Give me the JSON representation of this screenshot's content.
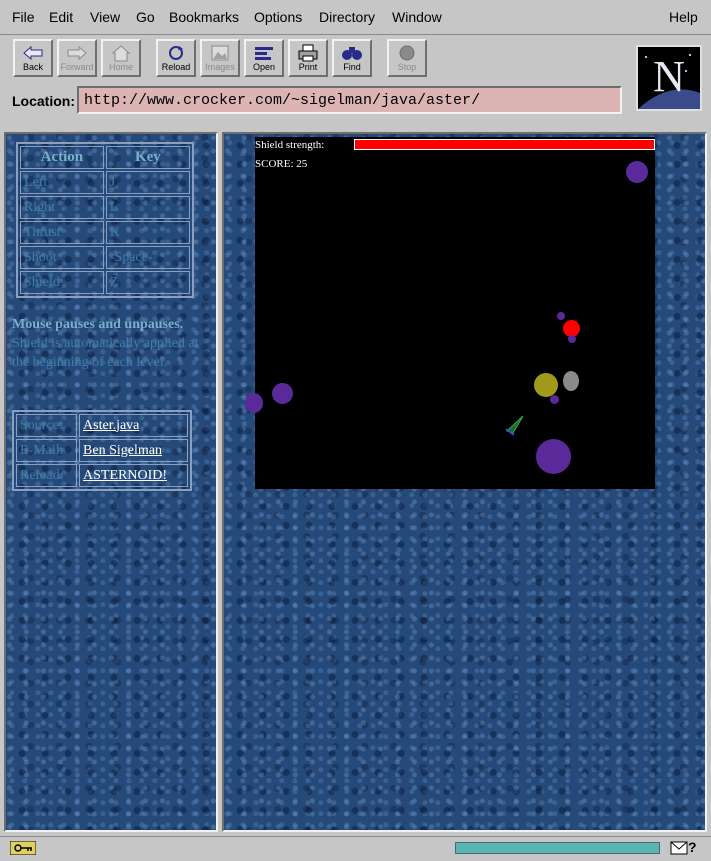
{
  "menu": {
    "file": "File",
    "edit": "Edit",
    "view": "View",
    "go": "Go",
    "bookmarks": "Bookmarks",
    "options": "Options",
    "directory": "Directory",
    "window": "Window",
    "help": "Help"
  },
  "toolbar": {
    "back": "Back",
    "forward": "Forward",
    "home": "Home",
    "reload": "Reload",
    "images": "Images",
    "open": "Open",
    "print": "Print",
    "find": "Find",
    "stop": "Stop"
  },
  "location": {
    "label": "Location:",
    "url": "http://www.crocker.com/~sigelman/java/aster/"
  },
  "logo": {
    "letter": "N"
  },
  "controls": {
    "headers": {
      "action": "Action",
      "key": "Key"
    },
    "rows": [
      {
        "action": "Left",
        "key": "J"
      },
      {
        "action": "Right",
        "key": "L"
      },
      {
        "action": "Thrust",
        "key": "K"
      },
      {
        "action": "Shoot",
        "key": "-Space-"
      },
      {
        "action": "Shield",
        "key": "Z"
      }
    ]
  },
  "help": {
    "bold": "Mouse pauses and unpauses.",
    "rest": " Shield is automatically applied at the beginning of each level."
  },
  "info": {
    "rows": [
      {
        "label": "Source:",
        "value": "Aster.java"
      },
      {
        "label": "E-Mail:",
        "value": "Ben Sigelman"
      },
      {
        "label": "Reload:",
        "value": "ASTERNOID!"
      }
    ]
  },
  "game": {
    "shield_label": "Shield strength:",
    "shield_level_percent": 100,
    "score_label": "SCORE: 25",
    "colors": {
      "shield": "#ff0000",
      "asteroid_purple": "#5a2a9a",
      "asteroid_red": "#ff0000",
      "asteroid_yellow": "#a09a1a",
      "asteroid_grey": "#8a8a8a",
      "ship": "#2a9a3a"
    }
  },
  "status": {
    "help_glyph": "?"
  }
}
